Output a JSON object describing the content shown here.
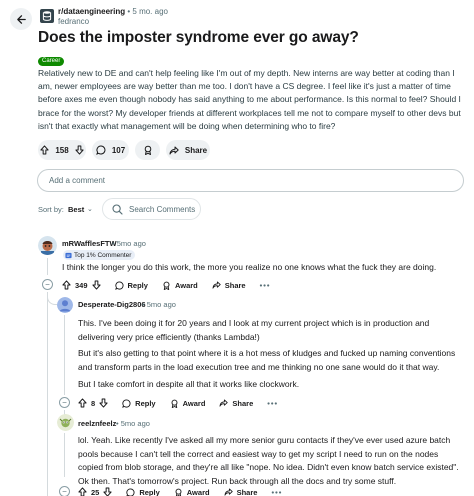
{
  "subreddit": {
    "name": "r/dataengineering",
    "age": "5 mo. ago",
    "author": "fedranco"
  },
  "post": {
    "title": "Does the imposter syndrome ever go away?",
    "flair": "Career",
    "body": "Relatively new to DE and can't help feeling like I'm out of my depth. New interns are way better at coding than I am, newer employees are way better than me too. I don't have a CS degree. I feel like it's just a matter of time before axes me even though nobody has said anything to me about performance. Is this normal to feel? Should I brace for the worst? My developer friends at different workplaces tell me not to compare myself to other devs but isn't that exactly what management will be doing when determining who to fire?",
    "votes": "158",
    "comments": "107",
    "share_label": "Share"
  },
  "add_comment_placeholder": "Add a comment",
  "sort": {
    "label": "Sort by:",
    "value": "Best"
  },
  "search_comments_label": "Search Comments",
  "actions": {
    "reply": "Reply",
    "award": "Award",
    "share": "Share"
  },
  "comments": [
    {
      "author": "mRWafflesFTW",
      "time": "5mo ago",
      "badge": "Top 1% Commenter",
      "text": "I think the longer you do this work, the more you realize no one knows what the fuck they are doing.",
      "votes": "349"
    },
    {
      "author": "Desperate-Dig2806",
      "time": "5mo ago",
      "paragraphs": [
        "This. I've been doing it for 20 years and I look at my current project which is in production and delivering very price efficiently (thanks Lambda!)",
        "But it's also getting to that point where it is a hot mess of kludges and fucked up naming conventions and transform parts in the load execution tree and me thinking no one sane would do it that way.",
        "But I take comfort in despite all that it works like clockwork."
      ],
      "votes": "8"
    },
    {
      "author": "reelznfeelz",
      "time": "5mo ago",
      "text": "lol. Yeah. Like recently I've asked all my more senior guru contacts if they've ever used azure batch pools because I can't tell the correct and easiest way to get my script I need to run on the nodes copied from blob storage, and they're all like \"nope. No idea. Didn't even know batch service existed\". Ok then. That's tomorrow's project. Run back through all the docs and try some stuff.",
      "votes": "25"
    }
  ],
  "colors": {
    "flair": "#0e8a00",
    "upvote": "#1a1a1b",
    "muted": "#576f76",
    "pill_bg": "#eef1f3"
  }
}
